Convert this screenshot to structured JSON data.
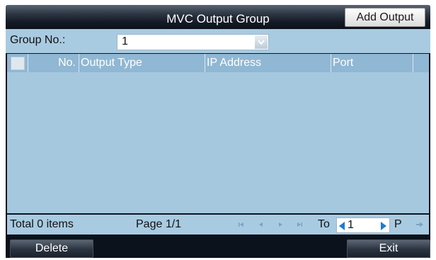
{
  "window": {
    "title": "MVC Output Group",
    "add_output_label": "Add Output"
  },
  "group": {
    "label": "Group No.:",
    "value": "1"
  },
  "table": {
    "columns": [
      "No.",
      "Output Type",
      "IP Address",
      "Port"
    ],
    "rows": []
  },
  "footer": {
    "total": "Total 0 items",
    "page": "Page 1/1",
    "to_label": "To",
    "page_input": "1",
    "p_label": "P"
  },
  "buttons": {
    "delete": "Delete",
    "exit": "Exit"
  },
  "colors": {
    "titlebar": "#141b26",
    "panel": "#a8cbe1",
    "header": "#90b7d3",
    "body": "#a5c8de",
    "arrow_accent": "#1f7ad6"
  }
}
